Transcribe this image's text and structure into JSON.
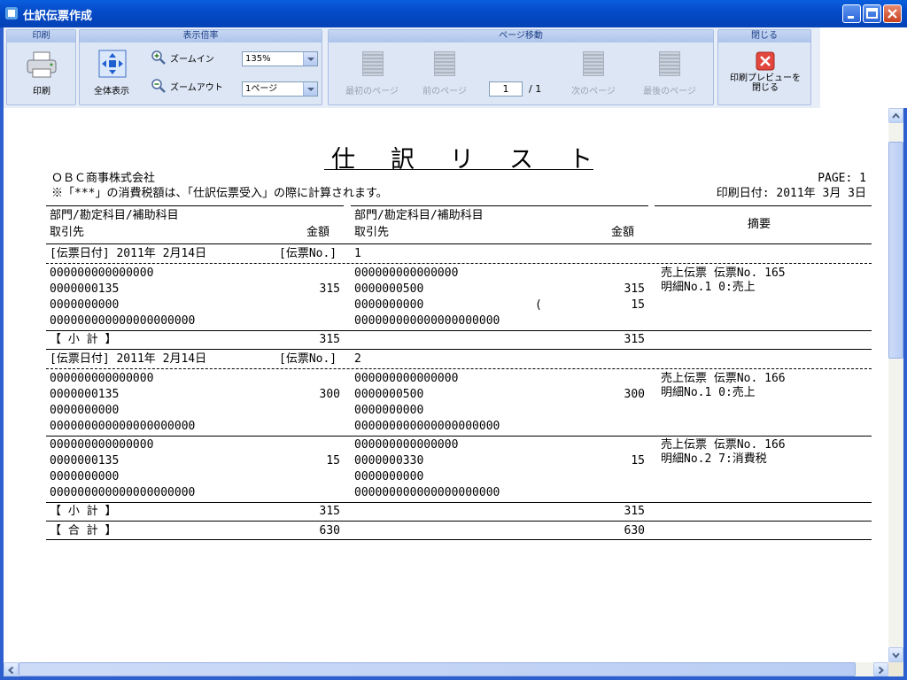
{
  "window": {
    "title": "仕訳伝票作成"
  },
  "ribbon": {
    "print_group": {
      "title": "印刷",
      "print_label": "印刷"
    },
    "zoom_group": {
      "title": "表示倍率",
      "fit_label": "全体表示",
      "zoom_in_label": "ズームイン",
      "zoom_out_label": "ズームアウト",
      "zoom_value": "135%",
      "page_view_value": "1ページ"
    },
    "nav_group": {
      "title": "ページ移動",
      "first_label": "最初のページ",
      "prev_label": "前のページ",
      "page_input": "1",
      "page_total": "/ 1",
      "next_label": "次のページ",
      "last_label": "最後のページ"
    },
    "close_group": {
      "title": "閉じる",
      "close_label_1": "印刷プレビューを",
      "close_label_2": "閉じる"
    }
  },
  "report": {
    "title": "仕訳リスト",
    "company": "ＯＢＣ商事株式会社",
    "note": "※「***」の消費税額は、「仕訳伝票受入」の際に計算されます。",
    "page_label": "PAGE:   1",
    "print_date": "印刷日付: 2011年 3月 3日",
    "col_account": "部門/勘定科目/補助科目",
    "col_partner": "取引先",
    "col_amount": "金額",
    "col_memo": "摘要",
    "subtotal_label": "【 小   計 】",
    "total_label": "【 合   計 】",
    "total_debit": "630",
    "total_credit": "630",
    "vouchers": [
      {
        "date_label": "[伝票日付] 2011年 2月14日",
        "no_label": "[伝票No.]",
        "no": "1",
        "lines": [
          {
            "debit": [
              "000000000000000",
              "0000000135",
              "0000000000",
              "000000000000000000000"
            ],
            "debit_amount": "315",
            "credit": [
              "000000000000000",
              "0000000500",
              "0000000000",
              "000000000000000000000"
            ],
            "credit_amount": "315",
            "credit_tax_open": "(",
            "credit_tax": "15",
            "memo1": "売上伝票 伝票No.   165",
            "memo2": "明細No.1 0:売上"
          }
        ],
        "subtotal_debit": "315",
        "subtotal_credit": "315"
      },
      {
        "date_label": "[伝票日付] 2011年 2月14日",
        "no_label": "[伝票No.]",
        "no": "2",
        "lines": [
          {
            "debit": [
              "000000000000000",
              "0000000135",
              "0000000000",
              "000000000000000000000"
            ],
            "debit_amount": "300",
            "credit": [
              "000000000000000",
              "0000000500",
              "0000000000",
              "000000000000000000000"
            ],
            "credit_amount": "300",
            "memo1": "売上伝票 伝票No.   166",
            "memo2": "明細No.1 0:売上"
          },
          {
            "debit": [
              "000000000000000",
              "0000000135",
              "0000000000",
              "000000000000000000000"
            ],
            "debit_amount": "15",
            "credit": [
              "000000000000000",
              "0000000330",
              "0000000000",
              "000000000000000000000"
            ],
            "credit_amount": "15",
            "memo1": "売上伝票 伝票No.   166",
            "memo2": "明細No.2 7:消費税"
          }
        ],
        "subtotal_debit": "315",
        "subtotal_credit": "315"
      }
    ]
  }
}
